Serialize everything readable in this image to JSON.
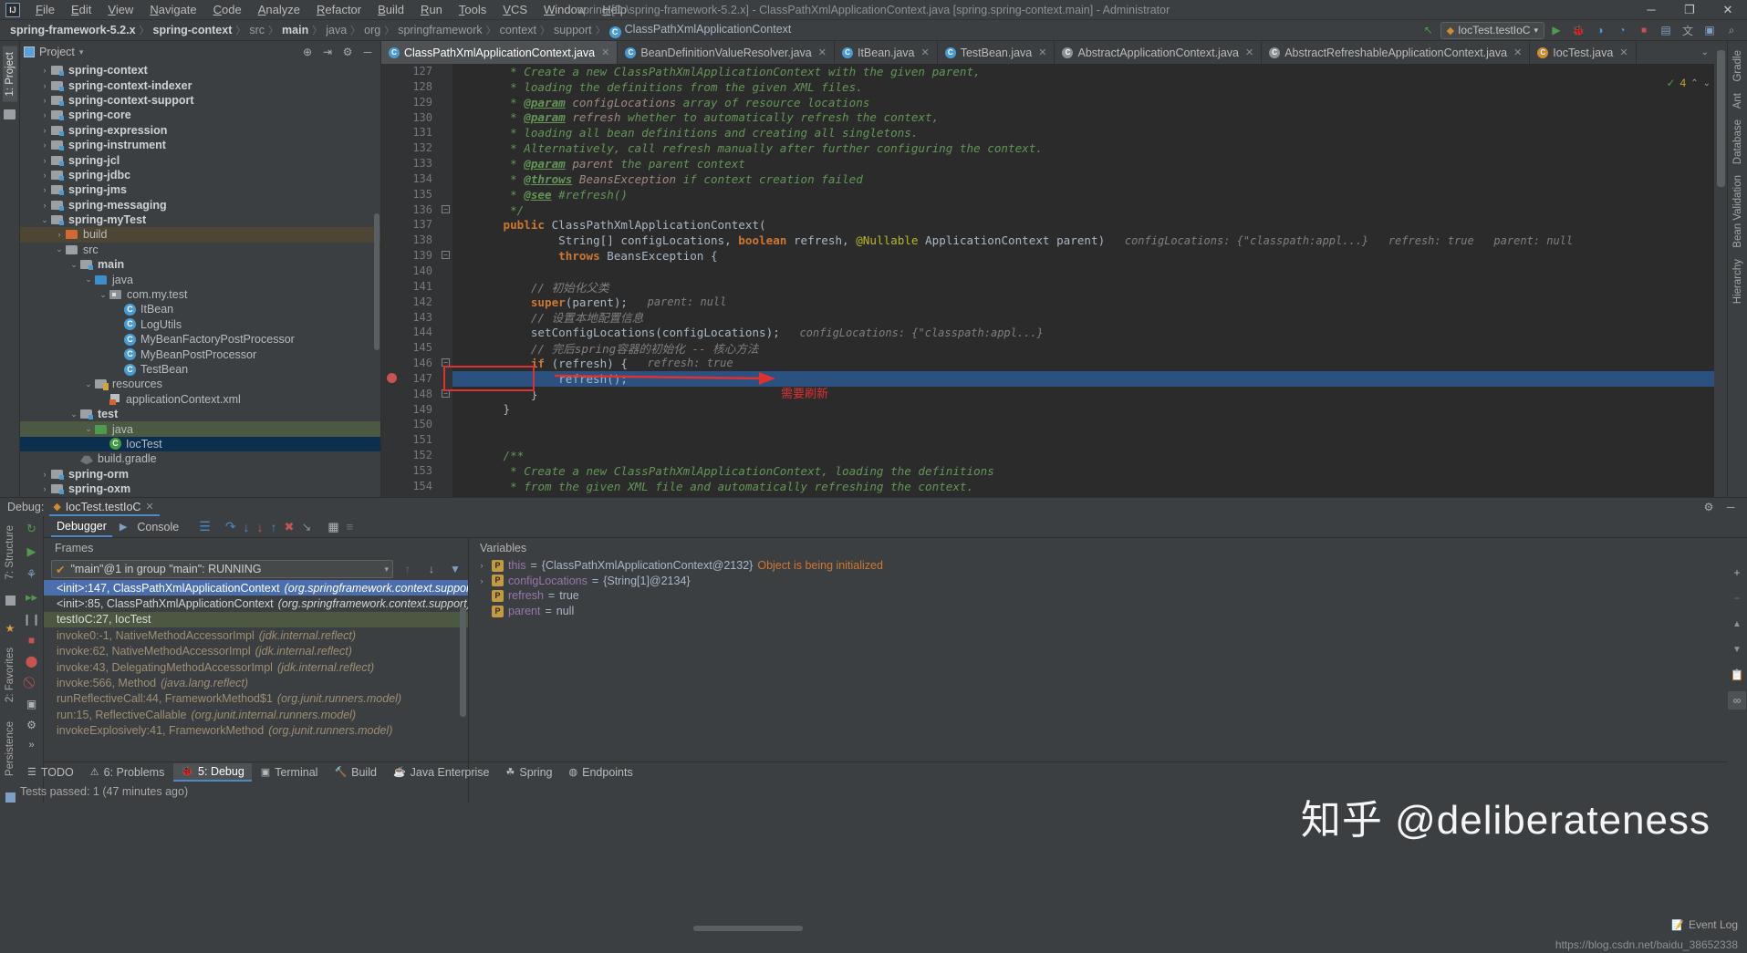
{
  "titlebar": {
    "logo": "IJ",
    "menus": [
      "File",
      "Edit",
      "View",
      "Navigate",
      "Code",
      "Analyze",
      "Refactor",
      "Build",
      "Run",
      "Tools",
      "VCS",
      "Window",
      "Help"
    ],
    "window_title": "spring [D:\\spring-framework-5.2.x] - ClassPathXmlApplicationContext.java [spring.spring-context.main] - Administrator",
    "minimize": "─",
    "maximize": "❐",
    "close": "✕"
  },
  "navbar": {
    "crumbs": [
      "spring-framework-5.2.x",
      "spring-context",
      "src",
      "main",
      "java",
      "org",
      "springframework",
      "context",
      "support",
      "ClassPathXmlApplicationContext"
    ],
    "separator": "〉",
    "run_config": "IocTest.testIoC",
    "run_config_caret": "▾",
    "back_icon": "↖",
    "run_icon": "▶",
    "debug_icon": "🐞",
    "coverage_icon": "◑",
    "profile_icon": "◔",
    "stop_icon": "■",
    "layout_icon": "▤",
    "translate_icon": "文",
    "device_icon": "▣",
    "search_icon": "⌕"
  },
  "leftstrip": {
    "project_tab": "1: Project",
    "structure_tab": "7: Structure",
    "favorites_tab": "2: Favorites",
    "persistence_tab": "Persistence"
  },
  "rightstrip": {
    "tabs": [
      "Gradle",
      "Ant",
      "Database",
      "Bean Validation",
      "Hierarchy"
    ]
  },
  "project_panel": {
    "title": "Project",
    "caret": "▾",
    "target_icon": "⊕",
    "collapse_icon": "⇥",
    "settings_icon": "⚙",
    "hide_icon": "─",
    "tree": [
      {
        "label": "spring-context",
        "depth": 1,
        "arrow": "›",
        "icon": "module",
        "bold": true,
        "state": ""
      },
      {
        "label": "spring-context-indexer",
        "depth": 1,
        "arrow": "›",
        "icon": "module",
        "bold": true,
        "state": ""
      },
      {
        "label": "spring-context-support",
        "depth": 1,
        "arrow": "›",
        "icon": "module",
        "bold": true,
        "state": ""
      },
      {
        "label": "spring-core",
        "depth": 1,
        "arrow": "›",
        "icon": "module",
        "bold": true,
        "state": ""
      },
      {
        "label": "spring-expression",
        "depth": 1,
        "arrow": "›",
        "icon": "module",
        "bold": true,
        "state": ""
      },
      {
        "label": "spring-instrument",
        "depth": 1,
        "arrow": "›",
        "icon": "module",
        "bold": true,
        "state": ""
      },
      {
        "label": "spring-jcl",
        "depth": 1,
        "arrow": "›",
        "icon": "module",
        "bold": true,
        "state": ""
      },
      {
        "label": "spring-jdbc",
        "depth": 1,
        "arrow": "›",
        "icon": "module",
        "bold": true,
        "state": ""
      },
      {
        "label": "spring-jms",
        "depth": 1,
        "arrow": "›",
        "icon": "module",
        "bold": true,
        "state": ""
      },
      {
        "label": "spring-messaging",
        "depth": 1,
        "arrow": "›",
        "icon": "module",
        "bold": true,
        "state": ""
      },
      {
        "label": "spring-myTest",
        "depth": 1,
        "arrow": "⌄",
        "icon": "module",
        "bold": true,
        "state": ""
      },
      {
        "label": "build",
        "depth": 2,
        "arrow": "›",
        "icon": "folder-orange",
        "bold": false,
        "state": "sel-build"
      },
      {
        "label": "src",
        "depth": 2,
        "arrow": "⌄",
        "icon": "folder-gray",
        "bold": false,
        "state": ""
      },
      {
        "label": "main",
        "depth": 3,
        "arrow": "⌄",
        "icon": "module",
        "bold": true,
        "state": ""
      },
      {
        "label": "java",
        "depth": 4,
        "arrow": "⌄",
        "icon": "folder-blue",
        "bold": false,
        "state": ""
      },
      {
        "label": "com.my.test",
        "depth": 5,
        "arrow": "⌄",
        "icon": "package",
        "bold": false,
        "state": ""
      },
      {
        "label": "ItBean",
        "depth": 6,
        "arrow": "",
        "icon": "class",
        "bold": false,
        "state": ""
      },
      {
        "label": "LogUtils",
        "depth": 6,
        "arrow": "",
        "icon": "class",
        "bold": false,
        "state": ""
      },
      {
        "label": "MyBeanFactoryPostProcessor",
        "depth": 6,
        "arrow": "",
        "icon": "class",
        "bold": false,
        "state": ""
      },
      {
        "label": "MyBeanPostProcessor",
        "depth": 6,
        "arrow": "",
        "icon": "class",
        "bold": false,
        "state": ""
      },
      {
        "label": "TestBean",
        "depth": 6,
        "arrow": "",
        "icon": "class",
        "bold": false,
        "state": ""
      },
      {
        "label": "resources",
        "depth": 4,
        "arrow": "⌄",
        "icon": "folder-res",
        "bold": false,
        "state": ""
      },
      {
        "label": "applicationContext.xml",
        "depth": 5,
        "arrow": "",
        "icon": "xml",
        "bold": false,
        "state": ""
      },
      {
        "label": "test",
        "depth": 3,
        "arrow": "⌄",
        "icon": "module",
        "bold": true,
        "state": ""
      },
      {
        "label": "java",
        "depth": 4,
        "arrow": "⌄",
        "icon": "folder-green",
        "bold": false,
        "state": "sel-green"
      },
      {
        "label": "IocTest",
        "depth": 5,
        "arrow": "",
        "icon": "class-test",
        "bold": false,
        "state": "sel-blue"
      },
      {
        "label": "build.gradle",
        "depth": 3,
        "arrow": "",
        "icon": "gradle",
        "bold": false,
        "state": ""
      },
      {
        "label": "spring-orm",
        "depth": 1,
        "arrow": "›",
        "icon": "module",
        "bold": true,
        "state": ""
      },
      {
        "label": "spring-oxm",
        "depth": 1,
        "arrow": "›",
        "icon": "module",
        "bold": true,
        "state": ""
      }
    ]
  },
  "editor": {
    "tabs": [
      {
        "label": "ClassPathXmlApplicationContext.java",
        "active": true,
        "icon": "class"
      },
      {
        "label": "BeanDefinitionValueResolver.java",
        "active": false,
        "icon": "class"
      },
      {
        "label": "ItBean.java",
        "active": false,
        "icon": "class"
      },
      {
        "label": "TestBean.java",
        "active": false,
        "icon": "class"
      },
      {
        "label": "AbstractApplicationContext.java",
        "active": false,
        "icon": "class-gray"
      },
      {
        "label": "AbstractRefreshableApplicationContext.java",
        "active": false,
        "icon": "class-gray"
      },
      {
        "label": "IocTest.java",
        "active": false,
        "icon": "class-test"
      }
    ],
    "tab_close": "✕",
    "tabs_overflow": "⌄",
    "inspection": {
      "count": "4",
      "up": "⌃",
      "down": "⌄",
      "check": "✓"
    },
    "first_line_number": 127,
    "highlight_line": 147,
    "lines": [
      {
        "n": 127,
        "segments": [
          {
            "t": "       * Create a new ClassPathXmlApplicationContext with the given parent,",
            "c": "cmt"
          }
        ]
      },
      {
        "n": 128,
        "segments": [
          {
            "t": "       * loading the definitions from the given XML files.",
            "c": "cmt"
          }
        ]
      },
      {
        "n": 129,
        "segments": [
          {
            "t": "       * ",
            "c": "cmt"
          },
          {
            "t": "@param",
            "c": "cmt-tag"
          },
          {
            "t": " configLocations",
            "c": "cmt-param"
          },
          {
            "t": " array of resource locations",
            "c": "cmt"
          }
        ]
      },
      {
        "n": 130,
        "segments": [
          {
            "t": "       * ",
            "c": "cmt"
          },
          {
            "t": "@param",
            "c": "cmt-tag"
          },
          {
            "t": " refresh",
            "c": "cmt-param"
          },
          {
            "t": " whether to automatically refresh the context,",
            "c": "cmt"
          }
        ]
      },
      {
        "n": 131,
        "segments": [
          {
            "t": "       * loading all bean definitions and creating all singletons.",
            "c": "cmt"
          }
        ]
      },
      {
        "n": 132,
        "segments": [
          {
            "t": "       * Alternatively, call refresh manually after further configuring the context.",
            "c": "cmt"
          }
        ]
      },
      {
        "n": 133,
        "segments": [
          {
            "t": "       * ",
            "c": "cmt"
          },
          {
            "t": "@param",
            "c": "cmt-tag"
          },
          {
            "t": " parent",
            "c": "cmt-param"
          },
          {
            "t": " the parent context",
            "c": "cmt"
          }
        ]
      },
      {
        "n": 134,
        "segments": [
          {
            "t": "       * ",
            "c": "cmt"
          },
          {
            "t": "@throws",
            "c": "cmt-tag"
          },
          {
            "t": " BeansException",
            "c": "cmt-param"
          },
          {
            "t": " if context creation failed",
            "c": "cmt"
          }
        ]
      },
      {
        "n": 135,
        "segments": [
          {
            "t": "       * ",
            "c": "cmt"
          },
          {
            "t": "@see",
            "c": "cmt-tag"
          },
          {
            "t": " #refresh()",
            "c": "cmt"
          }
        ]
      },
      {
        "n": 136,
        "segments": [
          {
            "t": "       */",
            "c": "cmt"
          }
        ]
      },
      {
        "n": 137,
        "segments": [
          {
            "t": "      ",
            "c": "txt"
          },
          {
            "t": "public",
            "c": "kw"
          },
          {
            "t": " ClassPathXmlApplicationContext(",
            "c": "txt"
          }
        ]
      },
      {
        "n": 138,
        "segments": [
          {
            "t": "              String[] configLocations, ",
            "c": "txt"
          },
          {
            "t": "boolean",
            "c": "kw"
          },
          {
            "t": " refresh, ",
            "c": "txt"
          },
          {
            "t": "@Nullable",
            "c": "ann"
          },
          {
            "t": " ApplicationContext parent)",
            "c": "txt"
          },
          {
            "t": "   configLocations: {\"classpath:appl...}   refresh: true   parent: null",
            "c": "hint"
          }
        ]
      },
      {
        "n": 139,
        "segments": [
          {
            "t": "              ",
            "c": "txt"
          },
          {
            "t": "throws",
            "c": "kw"
          },
          {
            "t": " BeansException {",
            "c": "txt"
          }
        ]
      },
      {
        "n": 140,
        "segments": [
          {
            "t": "",
            "c": "txt"
          }
        ]
      },
      {
        "n": 141,
        "segments": [
          {
            "t": "          // 初始化父类",
            "c": "cmt2"
          }
        ]
      },
      {
        "n": 142,
        "segments": [
          {
            "t": "          ",
            "c": "txt"
          },
          {
            "t": "super",
            "c": "kw"
          },
          {
            "t": "(parent);",
            "c": "txt"
          },
          {
            "t": "   parent: null",
            "c": "hint"
          }
        ]
      },
      {
        "n": 143,
        "segments": [
          {
            "t": "          // 设置本地配置信息",
            "c": "cmt2"
          }
        ]
      },
      {
        "n": 144,
        "segments": [
          {
            "t": "          setConfigLocations(configLocations);",
            "c": "txt"
          },
          {
            "t": "   configLocations: {\"classpath:appl...}",
            "c": "hint"
          }
        ]
      },
      {
        "n": 145,
        "segments": [
          {
            "t": "          // 完后spring容器的初始化 -- 核心方法",
            "c": "cmt2"
          }
        ]
      },
      {
        "n": 146,
        "segments": [
          {
            "t": "          ",
            "c": "txt"
          },
          {
            "t": "if",
            "c": "kw"
          },
          {
            "t": " (refresh) {",
            "c": "txt"
          },
          {
            "t": "   refresh: true",
            "c": "hint"
          }
        ]
      },
      {
        "n": 147,
        "segments": [
          {
            "t": "              refresh();",
            "c": "txt"
          }
        ]
      },
      {
        "n": 148,
        "segments": [
          {
            "t": "          }",
            "c": "txt"
          }
        ]
      },
      {
        "n": 149,
        "segments": [
          {
            "t": "      }",
            "c": "txt"
          }
        ]
      },
      {
        "n": 150,
        "segments": [
          {
            "t": "",
            "c": "txt"
          }
        ]
      },
      {
        "n": 151,
        "segments": [
          {
            "t": "",
            "c": "txt"
          }
        ]
      },
      {
        "n": 152,
        "segments": [
          {
            "t": "      /**",
            "c": "cmt"
          }
        ]
      },
      {
        "n": 153,
        "segments": [
          {
            "t": "       * Create a new ClassPathXmlApplicationContext, loading the definitions",
            "c": "cmt"
          }
        ]
      },
      {
        "n": 154,
        "segments": [
          {
            "t": "       * from the given XML file and automatically refreshing the context.",
            "c": "cmt"
          }
        ]
      }
    ],
    "annotation_text": "需要刷新"
  },
  "debug": {
    "label": "Debug:",
    "session_tab": "IocTest.testIoC",
    "session_close": "✕",
    "settings_icon": "⚙",
    "hide_icon": "─",
    "subtabs": [
      {
        "label": "Debugger",
        "active": true
      },
      {
        "label": "Console",
        "active": false
      }
    ],
    "toolbar_icons": [
      "layout-icon",
      "step-over-icon",
      "step-into-icon",
      "force-step-into-icon",
      "step-out-icon",
      "drop-frame-icon",
      "run-to-cursor-icon",
      "evaluate-icon",
      "mute-breakpoints-icon"
    ],
    "left_tool_icons": [
      "rerun-icon",
      "resume-icon",
      "mute-breakpoints-icon",
      "run-to-cursor-icon",
      "pause-icon",
      "stop-icon",
      "breakpoints-icon",
      "mute-bp-icon",
      "screenshot-icon",
      "settings-icon",
      "more-icon"
    ],
    "frames": {
      "title": "Frames",
      "thread": "\"main\"@1 in group \"main\": RUNNING",
      "thread_check": "✔",
      "thread_caret": "▾",
      "up_icon": "↑",
      "down_icon": "↓",
      "filter_icon": "▼",
      "items": [
        {
          "text": "<init>:147, ClassPathXmlApplicationContext",
          "pkg": "(org.springframework.context.support)",
          "state": "hl"
        },
        {
          "text": "<init>:85, ClassPathXmlApplicationContext",
          "pkg": "(org.springframework.context.support)",
          "state": "dark"
        },
        {
          "text": "testIoC:27, IocTest",
          "pkg": "",
          "state": "mine"
        },
        {
          "text": "invoke0:-1, NativeMethodAccessorImpl",
          "pkg": "(jdk.internal.reflect)",
          "state": ""
        },
        {
          "text": "invoke:62, NativeMethodAccessorImpl",
          "pkg": "(jdk.internal.reflect)",
          "state": ""
        },
        {
          "text": "invoke:43, DelegatingMethodAccessorImpl",
          "pkg": "(jdk.internal.reflect)",
          "state": ""
        },
        {
          "text": "invoke:566, Method",
          "pkg": "(java.lang.reflect)",
          "state": ""
        },
        {
          "text": "runReflectiveCall:44, FrameworkMethod$1",
          "pkg": "(org.junit.runners.model)",
          "state": ""
        },
        {
          "text": "run:15, ReflectiveCallable",
          "pkg": "(org.junit.internal.runners.model)",
          "state": ""
        },
        {
          "text": "invokeExplosively:41, FrameworkMethod",
          "pkg": "(org.junit.runners.model)",
          "state": ""
        }
      ]
    },
    "variables": {
      "title": "Variables",
      "add_icon": "+",
      "remove_icon": "−",
      "items": [
        {
          "chev": "›",
          "icon": "p",
          "name": "this",
          "eq": "=",
          "value": "{ClassPathXmlApplicationContext@2132}",
          "note": "Object is being initialized"
        },
        {
          "chev": "›",
          "icon": "p",
          "name": "configLocations",
          "eq": "=",
          "value": "{String[1]@2134}",
          "note": ""
        },
        {
          "chev": "",
          "icon": "p",
          "name": "refresh",
          "eq": "=",
          "value": "true",
          "note": ""
        },
        {
          "chev": "",
          "icon": "p",
          "name": "parent",
          "eq": "=",
          "value": "null",
          "note": ""
        }
      ]
    }
  },
  "bottom_toolbar": {
    "items": [
      {
        "label": "TODO",
        "icon": "☰",
        "active": false
      },
      {
        "label": "6: Problems",
        "icon": "⚠",
        "active": false
      },
      {
        "label": "5: Debug",
        "icon": "🐞",
        "active": true
      },
      {
        "label": "Terminal",
        "icon": "▣",
        "active": false
      },
      {
        "label": "Build",
        "icon": "🔨",
        "active": false
      },
      {
        "label": "Java Enterprise",
        "icon": "☕",
        "active": false
      },
      {
        "label": "Spring",
        "icon": "☘",
        "active": false
      },
      {
        "label": "Endpoints",
        "icon": "◍",
        "active": false
      }
    ],
    "event_log": "Event Log"
  },
  "statusbar": {
    "message": "Tests passed: 1 (47 minutes ago)",
    "right_info": ""
  },
  "watermark": {
    "zhihu": "知乎 @deliberateness",
    "url": "https://blog.csdn.net/baidu_38652338"
  }
}
